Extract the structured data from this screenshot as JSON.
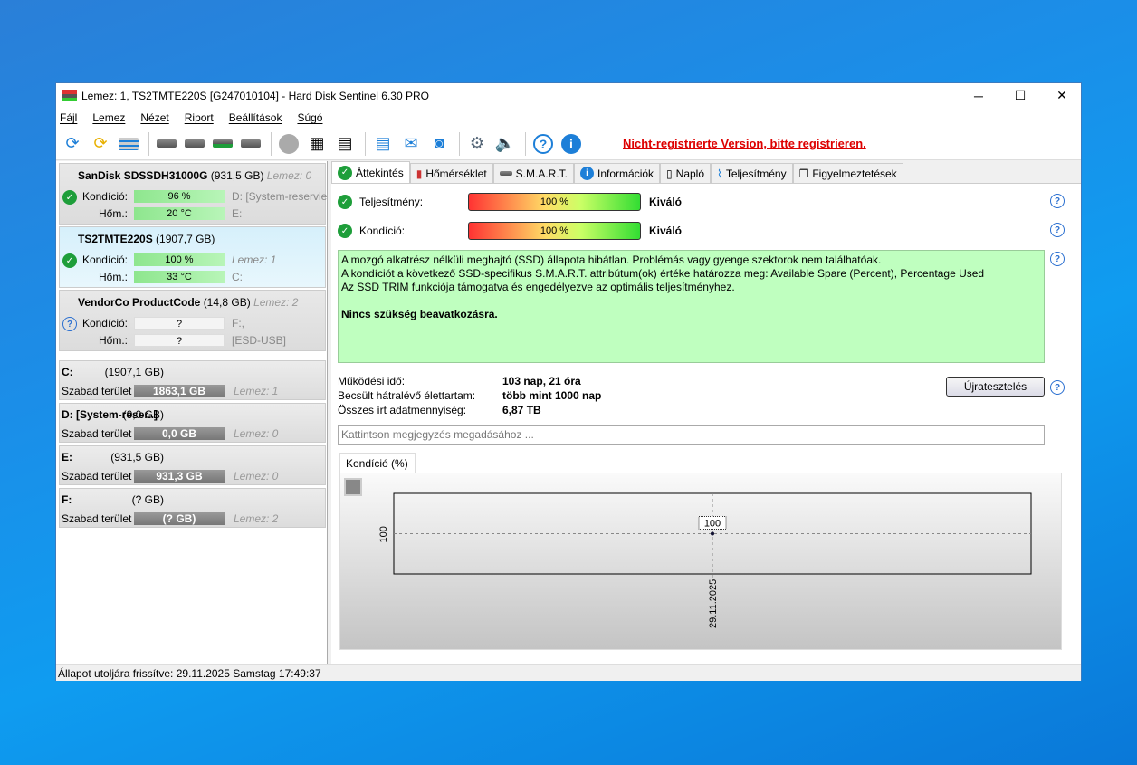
{
  "window": {
    "title": "Lemez: 1, TS2TMTE220S [G247010104]  -  Hard Disk Sentinel 6.30 PRO",
    "minimize": "─",
    "maximize": "☐",
    "close": "✕"
  },
  "menu": [
    "Fájl",
    "Lemez",
    "Nézet",
    "Riport",
    "Beállítások",
    "Súgó"
  ],
  "toolbar": {
    "register_link": "Nicht-registrierte Version, bitte registrieren."
  },
  "disks": [
    {
      "name": "SanDisk SDSSDH31000G",
      "size": "(931,5 GB)",
      "disk": "Lemez: 0",
      "status": "ok",
      "condition_label": "Kondíció:",
      "condition": "96 %",
      "temp_label": "Hőm.:",
      "temp": "20 °C",
      "right1": "D: [System-reservier",
      "right2": "E:"
    },
    {
      "name": "TS2TMTE220S",
      "size": "(1907,7 GB)",
      "disk": "",
      "status": "ok",
      "condition_label": "Kondíció:",
      "condition": "100 %",
      "temp_label": "Hőm.:",
      "temp": "33 °C",
      "right1": "Lemez: 1",
      "right2": "C:"
    },
    {
      "name": "VendorCo ProductCode",
      "size": "(14,8 GB)",
      "disk": "Lemez: 2",
      "status": "unknown",
      "condition_label": "Kondíció:",
      "condition": "?",
      "temp_label": "Hőm.:",
      "temp": "?",
      "right1": "F:,",
      "right2": "[ESD-USB]"
    }
  ],
  "partitions": [
    {
      "name": "C:",
      "size": "(1907,1 GB)",
      "free_label": "Szabad terület",
      "free": "1863,1 GB",
      "used_percent": 2,
      "disk": "Lemez: 1"
    },
    {
      "name": "D: [System-reser..]",
      "size": "(0,0 GB)",
      "free_label": "Szabad terület",
      "free": "0,0 GB",
      "used_percent": 30,
      "disk": "Lemez: 0"
    },
    {
      "name": "E:",
      "size": "(931,5 GB)",
      "free_label": "Szabad terület",
      "free": "931,3 GB",
      "used_percent": 0,
      "disk": "Lemez: 0"
    },
    {
      "name": "F:",
      "size": "(? GB)",
      "free_label": "Szabad terület",
      "free": "(? GB)",
      "used_percent": 100,
      "disk": "Lemez: 2"
    }
  ],
  "tabs": [
    "Áttekintés",
    "Hőmérséklet",
    "S.M.A.R.T.",
    "Információk",
    "Napló",
    "Teljesítmény",
    "Figyelmeztetések"
  ],
  "overview": {
    "performance_label": "Teljesítmény:",
    "performance": "100 %",
    "performance_percent": 100,
    "performance_rating": "Kiváló",
    "condition_label": "Kondíció:",
    "condition": "100 %",
    "condition_percent": 100,
    "condition_rating": "Kiváló",
    "message": [
      "A mozgó alkatrész nélküli meghajtó (SSD) állapota hibátlan. Problémás vagy gyenge szektorok nem találhatóak.",
      "A kondíciót a következő SSD-specifikus S.M.A.R.T. attribútum(ok) értéke határozza meg:  Available Spare (Percent), Percentage Used",
      "Az SSD TRIM funkciója támogatva és engedélyezve az optimális teljesítményhez."
    ],
    "message_bold": "Nincs szükség beavatkozásra.",
    "uptime_label": "Működési idő:",
    "uptime": "103 nap, 21 óra",
    "remaining_label": "Becsült hátralévő élettartam:",
    "remaining": "több mint 1000 nap",
    "written_label": "Összes írt adatmennyiség:",
    "written": "6,87 TB",
    "retest_button": "Újratesztelés",
    "note_placeholder": "Kattintson megjegyzés megadásához ..."
  },
  "chart_data": {
    "type": "line",
    "tab_label": "Kondíció  (%)",
    "x": [
      "29.11.2025"
    ],
    "values": [
      100
    ],
    "data_labels": [
      "100"
    ],
    "y_ticks": [
      "100"
    ],
    "grid": true
  },
  "status": "Állapot utoljára frissítve: 29.11.2025 Samstag 17:49:37"
}
